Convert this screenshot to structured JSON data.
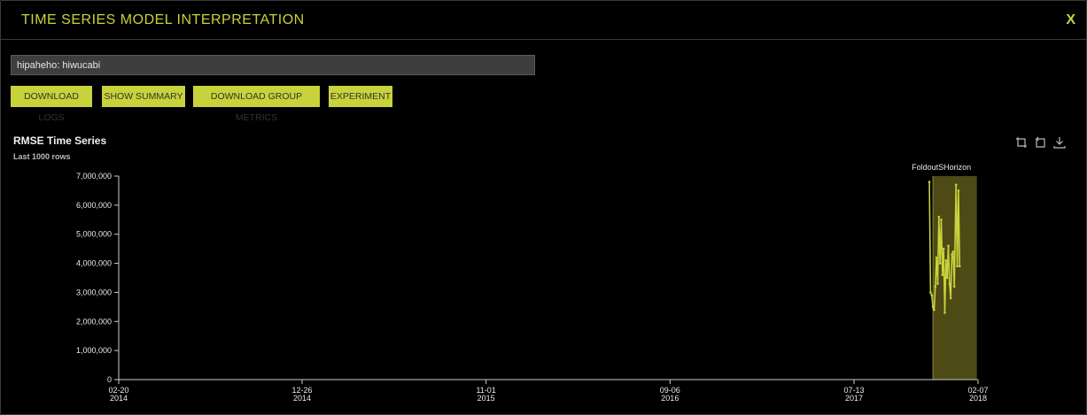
{
  "header": {
    "title": "TIME SERIES MODEL INTERPRETATION",
    "close_label": "X"
  },
  "selector": {
    "value": "hipaheho: hiwucabi"
  },
  "buttons": [
    "DOWNLOAD LOGS",
    "SHOW SUMMARY",
    "DOWNLOAD GROUP METRICS",
    "EXPERIMENT"
  ],
  "chart": {
    "title": "RMSE Time Series",
    "subtitle": "Last 1000 rows"
  },
  "toolbar": {
    "icons": [
      "select-icon",
      "reset-icon",
      "download-icon"
    ]
  },
  "colors": {
    "accent": "#c8d23a",
    "background": "#000000",
    "band": "#4d4a16"
  },
  "chart_data": {
    "type": "line",
    "x_type": "date",
    "xlim": [
      "2014-02-20",
      "2018-02-07"
    ],
    "x_ticks": [
      {
        "date": "2014-02-20",
        "line1": "02-20",
        "line2": "2014"
      },
      {
        "date": "2014-12-26",
        "line1": "12-26",
        "line2": "2014"
      },
      {
        "date": "2015-11-01",
        "line1": "11-01",
        "line2": "2015"
      },
      {
        "date": "2016-09-06",
        "line1": "09-06",
        "line2": "2016"
      },
      {
        "date": "2017-07-13",
        "line1": "07-13",
        "line2": "2017"
      },
      {
        "date": "2018-02-07",
        "line1": "02-07",
        "line2": "2018"
      }
    ],
    "ylim": [
      0,
      7000000
    ],
    "y_ticks": [
      {
        "value": 0,
        "label": "0"
      },
      {
        "value": 1000000,
        "label": "1,000,000"
      },
      {
        "value": 2000000,
        "label": "2,000,000"
      },
      {
        "value": 3000000,
        "label": "3,000,000"
      },
      {
        "value": 4000000,
        "label": "4,000,000"
      },
      {
        "value": 5000000,
        "label": "5,000,000"
      },
      {
        "value": 6000000,
        "label": "6,000,000"
      },
      {
        "value": 7000000,
        "label": "7,000,000"
      }
    ],
    "annotation": {
      "label": "FoldoutSHorizon",
      "range": [
        "2017-11-23",
        "2018-02-05"
      ]
    },
    "series": [
      {
        "color": "#c8d23a",
        "points": [
          [
            "2017-11-17",
            6800000
          ],
          [
            "2017-11-19",
            3000000
          ],
          [
            "2017-11-21",
            2900000
          ],
          [
            "2017-11-23",
            2500000
          ],
          [
            "2017-11-25",
            2400000
          ],
          [
            "2017-11-27",
            3200000
          ],
          [
            "2017-11-29",
            4200000
          ],
          [
            "2017-12-01",
            3300000
          ],
          [
            "2017-12-03",
            5600000
          ],
          [
            "2017-12-05",
            4000000
          ],
          [
            "2017-12-07",
            5500000
          ],
          [
            "2017-12-09",
            3600000
          ],
          [
            "2017-12-11",
            4500000
          ],
          [
            "2017-12-13",
            2300000
          ],
          [
            "2017-12-15",
            4100000
          ],
          [
            "2017-12-17",
            3500000
          ],
          [
            "2017-12-19",
            4600000
          ],
          [
            "2017-12-21",
            3300000
          ],
          [
            "2017-12-23",
            2800000
          ],
          [
            "2017-12-25",
            4300000
          ],
          [
            "2017-12-27",
            4400000
          ],
          [
            "2017-12-29",
            3200000
          ],
          [
            "2018-01-01",
            6700000
          ],
          [
            "2018-01-03",
            3900000
          ],
          [
            "2018-01-05",
            6500000
          ],
          [
            "2018-01-07",
            3900000
          ]
        ]
      }
    ]
  }
}
